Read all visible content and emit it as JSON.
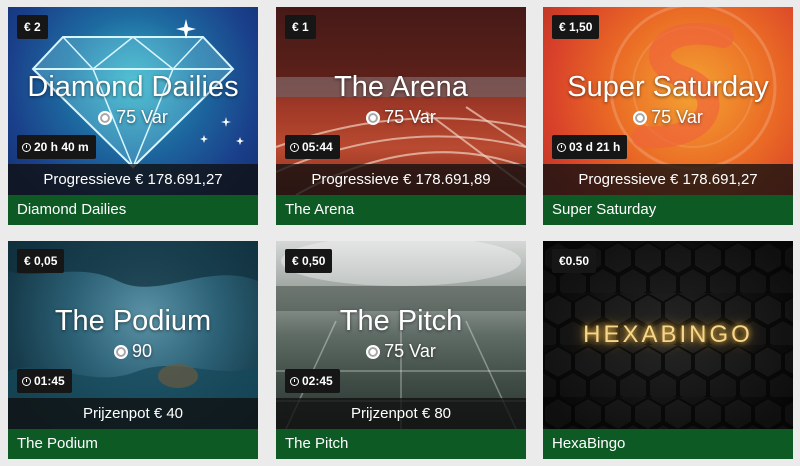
{
  "cards": [
    {
      "price": "€ 2",
      "title": "Diamond Dailies",
      "balls": "75 Var",
      "timer": "20 h 40 m",
      "jackpot": "Progressieve € 178.691,27",
      "name": "Diamond Dailies"
    },
    {
      "price": "€ 1",
      "title": "The Arena",
      "balls": "75 Var",
      "timer": "05:44",
      "jackpot": "Progressieve € 178.691,89",
      "name": "The Arena"
    },
    {
      "price": "€ 1,50",
      "title": "Super Saturday",
      "balls": "75 Var",
      "timer": "03 d 21 h",
      "jackpot": "Progressieve € 178.691,27",
      "name": "Super Saturday"
    },
    {
      "price": "€ 0,05",
      "title": "The Podium",
      "balls": "90",
      "timer": "01:45",
      "jackpot": "Prijzenpot € 40",
      "name": "The Podium"
    },
    {
      "price": "€ 0,50",
      "title": "The Pitch",
      "balls": "75 Var",
      "timer": "02:45",
      "jackpot": "Prijzenpot € 80",
      "name": "The Pitch"
    },
    {
      "price": "€0.50",
      "logo": "HEXABINGO",
      "name": "HexaBingo"
    }
  ],
  "colors": {
    "footer_green": "#0d5a24",
    "badge_dark": "#161616",
    "page_bg": "#ebebeb"
  }
}
